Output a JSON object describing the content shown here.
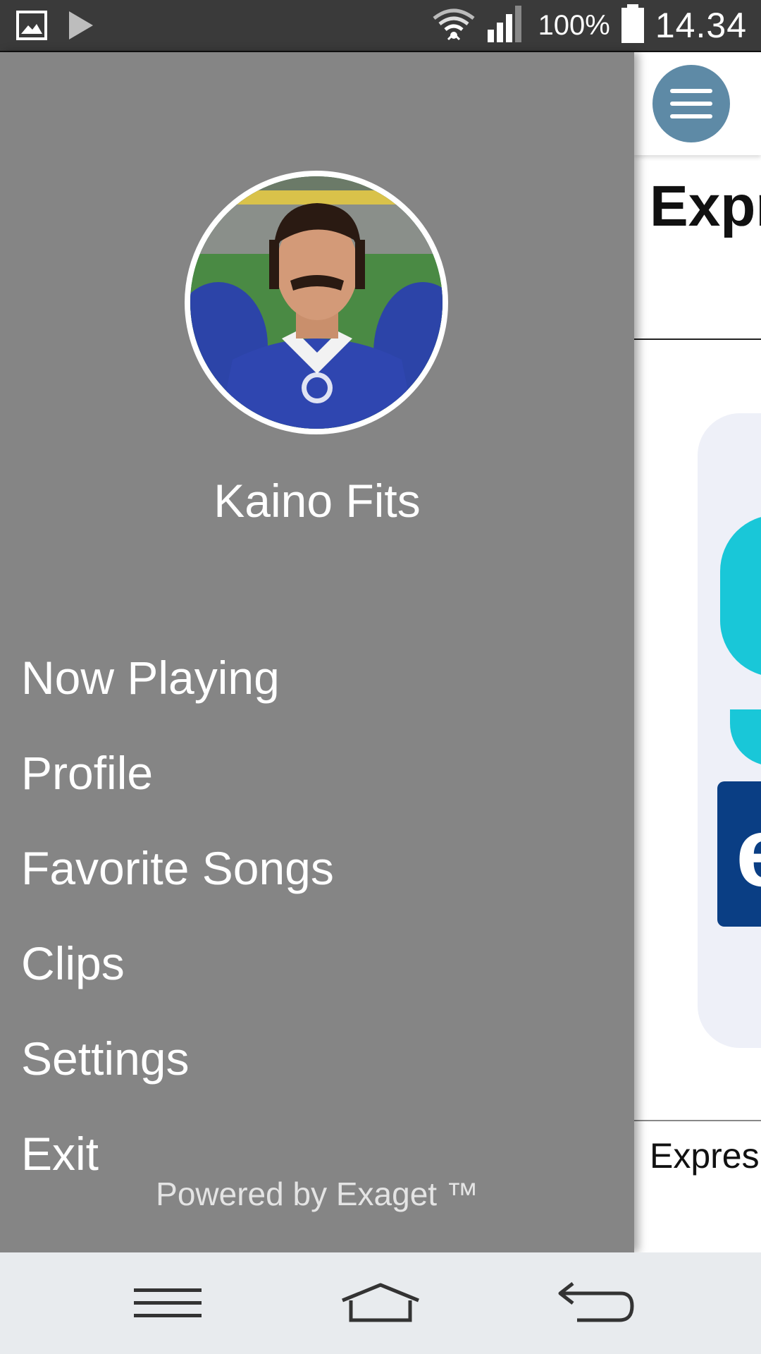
{
  "status_bar": {
    "battery_percent": "100%",
    "time": "14.34",
    "icons": [
      "image-icon",
      "play-icon",
      "wifi-icon",
      "signal-icon",
      "battery-icon"
    ]
  },
  "drawer": {
    "user_name": "Kaino Fits",
    "menu_items": [
      {
        "label": "Now Playing"
      },
      {
        "label": "Profile"
      },
      {
        "label": "Favorite Songs"
      },
      {
        "label": "Clips"
      },
      {
        "label": "Settings"
      },
      {
        "label": "Exit"
      }
    ],
    "footer": "Powered by Exaget ™"
  },
  "background_app": {
    "title": "Expr",
    "caption": "Expres",
    "logo_letter": "e",
    "accent_color": "#5e8aa6",
    "teal_color": "#19c7d8",
    "navy_color": "#0a3e84"
  },
  "nav_bar": {
    "icons": [
      "menu-icon",
      "home-icon",
      "back-icon"
    ]
  }
}
